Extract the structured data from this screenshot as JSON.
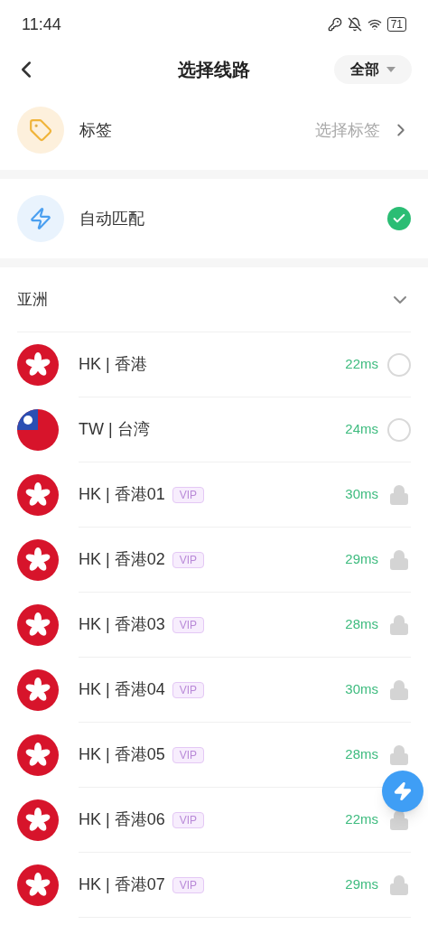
{
  "status_bar": {
    "time": "11:44",
    "battery": "71"
  },
  "header": {
    "title": "选择线路",
    "filter": "全部"
  },
  "tag_row": {
    "label": "标签",
    "value": "选择标签"
  },
  "auto_row": {
    "label": "自动匹配",
    "selected": true
  },
  "region": {
    "name": "亚洲",
    "expanded": true
  },
  "servers": [
    {
      "flag": {
        "kind": "hk"
      },
      "name": "HK | 香港",
      "latency": "22ms",
      "kind": "free",
      "selected": false
    },
    {
      "flag": {
        "kind": "tw"
      },
      "name": "TW | 台湾",
      "latency": "24ms",
      "kind": "free",
      "selected": false
    },
    {
      "flag": {
        "kind": "hk"
      },
      "name": "HK | 香港01",
      "badge": "VIP",
      "latency": "30ms",
      "kind": "locked"
    },
    {
      "flag": {
        "kind": "hk"
      },
      "name": "HK | 香港02",
      "badge": "VIP",
      "latency": "29ms",
      "kind": "locked"
    },
    {
      "flag": {
        "kind": "hk"
      },
      "name": "HK | 香港03",
      "badge": "VIP",
      "latency": "28ms",
      "kind": "locked"
    },
    {
      "flag": {
        "kind": "hk"
      },
      "name": "HK | 香港04",
      "badge": "VIP",
      "latency": "30ms",
      "kind": "locked"
    },
    {
      "flag": {
        "kind": "hk"
      },
      "name": "HK | 香港05",
      "badge": "VIP",
      "latency": "28ms",
      "kind": "locked"
    },
    {
      "flag": {
        "kind": "hk"
      },
      "name": "HK | 香港06",
      "badge": "VIP",
      "latency": "22ms",
      "kind": "locked"
    },
    {
      "flag": {
        "kind": "hk"
      },
      "name": "HK | 香港07",
      "badge": "VIP",
      "latency": "29ms",
      "kind": "locked"
    }
  ]
}
